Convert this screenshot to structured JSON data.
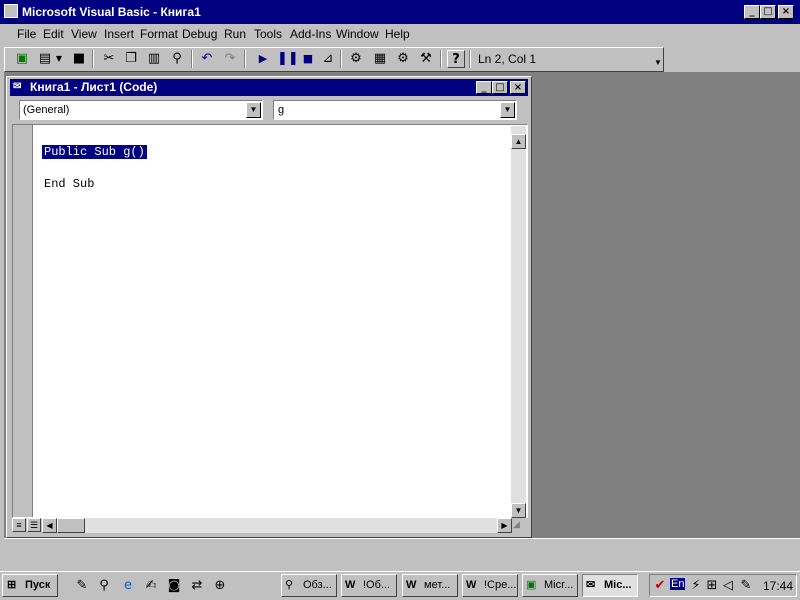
{
  "app": {
    "title": "Microsoft Visual Basic - Книга1"
  },
  "menu": [
    {
      "label": "File"
    },
    {
      "label": "Edit"
    },
    {
      "label": "View"
    },
    {
      "label": "Insert"
    },
    {
      "label": "Format"
    },
    {
      "label": "Debug"
    },
    {
      "label": "Run"
    },
    {
      "label": "Tools"
    },
    {
      "label": "Add-Ins"
    },
    {
      "label": "Window"
    },
    {
      "label": "Help"
    }
  ],
  "toolbar": {
    "position": "Ln 2, Col 1"
  },
  "code_window": {
    "title": "Книга1 - Лист1 (Code)",
    "object_combo": "(General)",
    "proc_combo": "g",
    "lines": [
      "Public Sub g()",
      "End Sub"
    ]
  },
  "taskbar": {
    "start_label": "Пуск",
    "buttons": [
      {
        "label": "Обз..."
      },
      {
        "label": "!Об..."
      },
      {
        "label": "мет..."
      },
      {
        "label": "!Сре..."
      },
      {
        "label": "Micr..."
      },
      {
        "label": "Mic..."
      }
    ],
    "language": "En",
    "clock": "17:44"
  }
}
